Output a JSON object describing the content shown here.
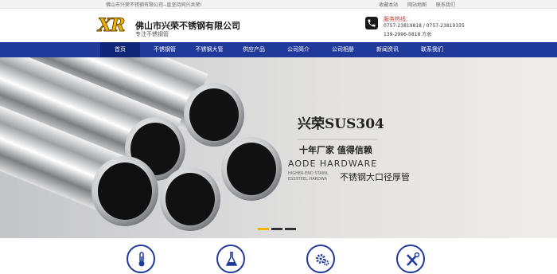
{
  "topbar": {
    "notice": "佛山市兴荣不锈钢有限公司--直坚持同兴共荣!",
    "links": [
      "收藏本站",
      "网站地图",
      "联系我们"
    ]
  },
  "header": {
    "logo_text": "XR",
    "company_name": "佛山市兴荣不锈钢有限公司",
    "company_sub": "专注不锈钢管",
    "hotline_label": "服务热线：",
    "hotline_line1": "0757-23819818 / 0757-23819335",
    "hotline_line2": "139-2996-5818 方总"
  },
  "nav": {
    "items": [
      "首页",
      "不锈钢管",
      "不锈钢大管",
      "供应产品",
      "公司简介",
      "公司相册",
      "新闻资讯",
      "联系我们"
    ]
  },
  "banner": {
    "tag": "兴荣SUS304",
    "slogan": "十年厂家 值得信赖",
    "brand_en": "AODE HARDWARE",
    "small_en_1": "HIGHER-END STAINL",
    "small_en_2": "ESSSTEEL HARDWA",
    "product_desc": "不锈钢大口径厚管",
    "active_slide": 1,
    "slide_count": 3
  },
  "features": {
    "icons": [
      "thermometer-icon",
      "flask-icon",
      "gears-icon",
      "tools-icon"
    ]
  },
  "colors": {
    "nav": "#1f3a9b",
    "nav_active": "#0f2577",
    "accent": "#f4b400",
    "hotline": "#c0392b"
  }
}
